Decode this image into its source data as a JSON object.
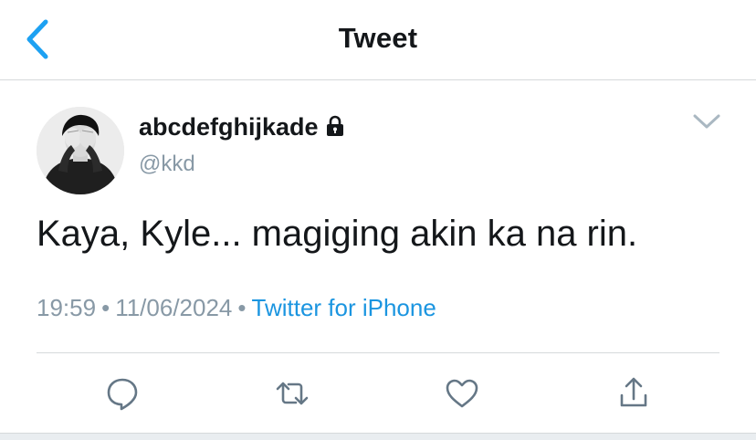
{
  "header": {
    "title": "Tweet",
    "back_icon": "chevron-left-icon",
    "accent_color": "#1da1f2"
  },
  "tweet": {
    "display_name": "abcdefghijkade",
    "protected_icon": "lock-icon",
    "handle": "@kkd",
    "text": "Kaya, Kyle... magiging akin ka na rin.",
    "time": "19:59",
    "date": "11/06/2024",
    "separator": "•",
    "source": "Twitter for iPhone",
    "source_color": "#1b95e0",
    "menu_icon": "chevron-down-icon"
  },
  "actions": [
    {
      "name": "reply",
      "icon": "reply-bubble-icon"
    },
    {
      "name": "retweet",
      "icon": "retweet-icon"
    },
    {
      "name": "like",
      "icon": "heart-icon"
    },
    {
      "name": "share",
      "icon": "share-icon"
    }
  ]
}
